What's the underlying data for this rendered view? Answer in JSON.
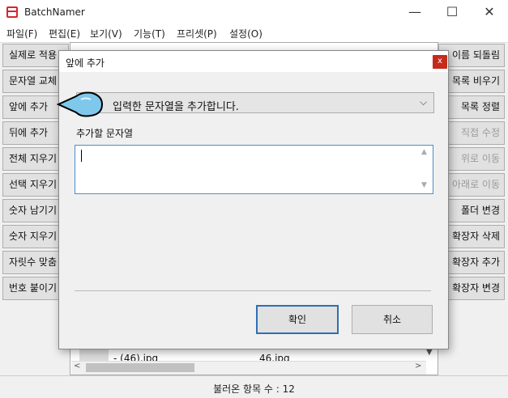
{
  "window": {
    "title": "BatchNamer",
    "minimize": "—",
    "maximize": "☐",
    "close": "✕"
  },
  "menu": [
    "파일(F)",
    "편집(E)",
    "보기(V)",
    "기능(T)",
    "프리셋(P)",
    "설정(O)"
  ],
  "left_buttons": [
    "실제로 적용",
    "문자열 교체",
    "앞에 추가",
    "뒤에 추가",
    "전체 지우기",
    "선택 지우기",
    "숫자 남기기",
    "숫자 지우기",
    "자릿수 맞춤",
    "번호 붙이기"
  ],
  "right_buttons": [
    {
      "label": "이름 되돌림",
      "disabled": false
    },
    {
      "label": "목록 비우기",
      "disabled": false
    },
    {
      "label": "목록 정렬",
      "disabled": false
    },
    {
      "label": "직접 수정",
      "disabled": true
    },
    {
      "label": "위로 이동",
      "disabled": true
    },
    {
      "label": "아래로 이동",
      "disabled": true
    },
    {
      "label": "폴더 변경",
      "disabled": false
    },
    {
      "label": "확장자 삭제",
      "disabled": false
    },
    {
      "label": "확장자 추가",
      "disabled": false
    },
    {
      "label": "확장자 변경",
      "disabled": false
    }
  ],
  "list": {
    "visible_row": {
      "current": "- (46).jpg",
      "new": "46.jpg"
    }
  },
  "status": {
    "text": "불러온 항목 수 : 12"
  },
  "dialog": {
    "title": "앞에 추가",
    "close": "x",
    "mode_select": "입력한 문자열을 추가합니다.",
    "field_label": "추가할 문자열",
    "field_value": "",
    "ok": "확인",
    "cancel": "취소"
  }
}
